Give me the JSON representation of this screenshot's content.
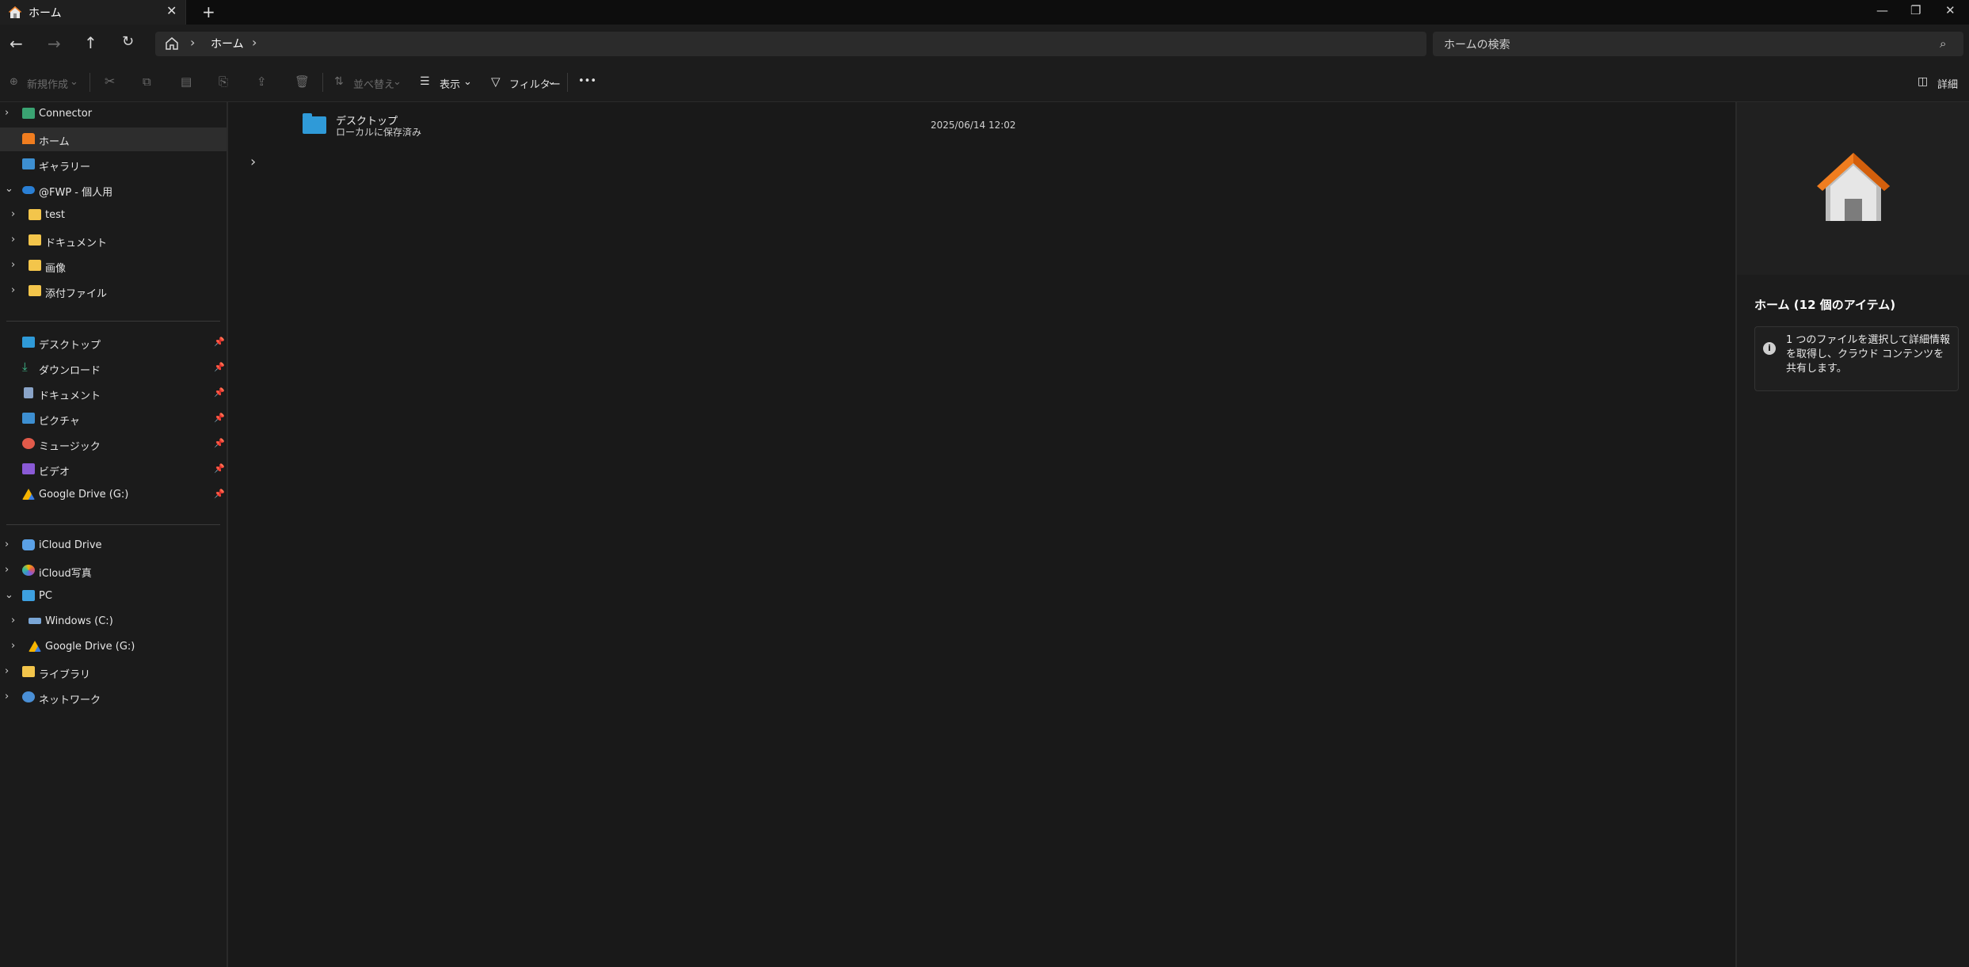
{
  "tab": {
    "title": "ホーム"
  },
  "address": {
    "crumb": "ホーム"
  },
  "search": {
    "placeholder": "ホームの検索"
  },
  "toolbar": {
    "new_label": "新規作成",
    "sort_label": "並べ替え",
    "view_label": "表示",
    "filter_label": "フィルター",
    "more_label": "•••",
    "details_label": "詳細"
  },
  "sidebar": {
    "connector": "Connector",
    "home": "ホーム",
    "gallery": "ギャラリー",
    "onedrive": "@FWP - 個人用",
    "od_items": [
      "test",
      "ドキュメント",
      "画像",
      "添付ファイル"
    ],
    "quick": [
      "デスクトップ",
      "ダウンロード",
      "ドキュメント",
      "ピクチャ",
      "ミュージック",
      "ビデオ",
      "Google Drive (G:)"
    ],
    "icloud_drive": "iCloud Drive",
    "icloud_photos": "iCloud写真",
    "pc": "PC",
    "pc_items": [
      "Windows (C:)",
      "Google Drive (G:)"
    ],
    "library": "ライブラリ",
    "network": "ネットワーク"
  },
  "content": {
    "items": [
      {
        "name": "デスクトップ",
        "sub": "ローカルに保存済み",
        "date": "2025/06/14 12:02"
      }
    ]
  },
  "details": {
    "title": "ホーム (12 個のアイテム)",
    "info": "1 つのファイルを選択して詳細情報を取得し、クラウド コンテンツを共有します。"
  }
}
